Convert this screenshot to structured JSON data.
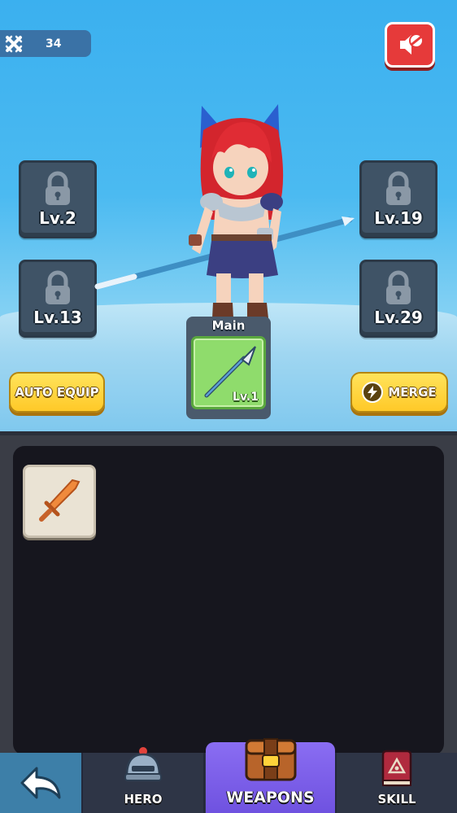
{
  "hud": {
    "stat_icon": "crossed-swords-icon",
    "stat_value": "34",
    "top_right_button_icon": "mute-icon"
  },
  "locked_slots": [
    {
      "level": "Lv.2"
    },
    {
      "level": "Lv.13"
    },
    {
      "level": "Lv.19"
    },
    {
      "level": "Lv.29"
    }
  ],
  "main_slot": {
    "label": "Main",
    "item_icon": "spear-icon",
    "level": "Lv.1"
  },
  "buttons": {
    "auto_equip": "AUTO EQUIP",
    "merge": "MERGE"
  },
  "inventory": {
    "items": [
      {
        "icon": "sword-icon"
      }
    ]
  },
  "nav": {
    "back_icon": "back-arrow-icon",
    "tabs": [
      {
        "label": "HERO",
        "icon": "helmet-icon"
      },
      {
        "label": "WEAPONS",
        "icon": "chest-icon",
        "active": true
      },
      {
        "label": "SKILL",
        "icon": "spellbook-icon"
      }
    ]
  },
  "colors": {
    "sky": "#3bb0ef",
    "accent_yellow": "#ffc928",
    "active_tab": "#7a5ee8",
    "main_slot_green": "#8fdc6c"
  }
}
